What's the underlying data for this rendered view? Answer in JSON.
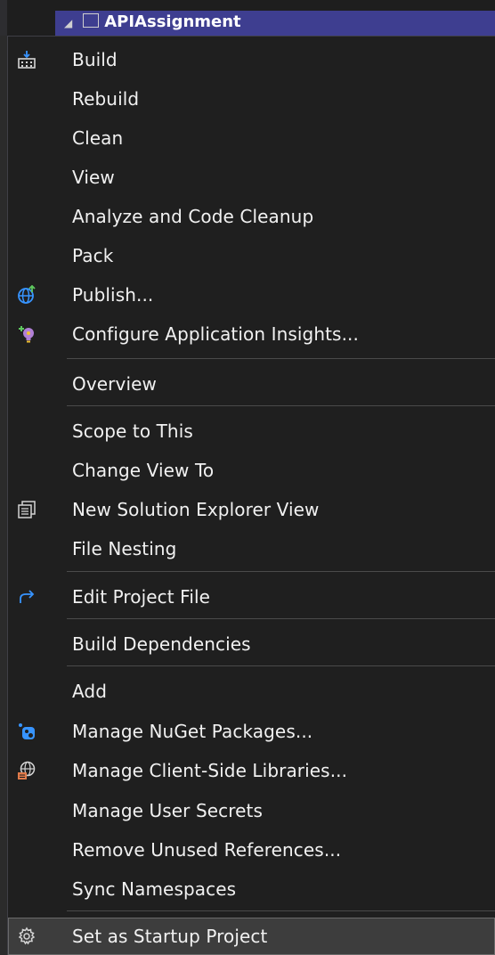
{
  "tree": {
    "selected_item": "APIAssignment"
  },
  "menu": {
    "items": [
      {
        "label": "Build",
        "icon": "build-icon"
      },
      {
        "label": "Rebuild",
        "icon": null
      },
      {
        "label": "Clean",
        "icon": null
      },
      {
        "label": "View",
        "icon": null
      },
      {
        "label": "Analyze and Code Cleanup",
        "icon": null
      },
      {
        "label": "Pack",
        "icon": null
      },
      {
        "label": "Publish...",
        "icon": "globe-publish-icon"
      },
      {
        "label": "Configure Application Insights...",
        "icon": "app-insights-lightbulb-icon"
      },
      {
        "label": "Overview",
        "icon": null
      },
      {
        "label": "Scope to This",
        "icon": null
      },
      {
        "label": "Change View To",
        "icon": null
      },
      {
        "label": "New Solution Explorer View",
        "icon": "solution-explorer-window-icon"
      },
      {
        "label": "File Nesting",
        "icon": null
      },
      {
        "label": "Edit Project File",
        "icon": "redo-arrow-icon"
      },
      {
        "label": "Build Dependencies",
        "icon": null
      },
      {
        "label": "Add",
        "icon": null
      },
      {
        "label": "Manage NuGet Packages...",
        "icon": "nuget-icon"
      },
      {
        "label": "Manage Client-Side Libraries...",
        "icon": "client-libraries-globe-icon"
      },
      {
        "label": "Manage User Secrets",
        "icon": null
      },
      {
        "label": "Remove Unused References...",
        "icon": null
      },
      {
        "label": "Sync Namespaces",
        "icon": null
      },
      {
        "label": "Set as Startup Project",
        "icon": "gear-icon"
      }
    ],
    "highlighted_item": "Set as Startup Project"
  },
  "colors": {
    "menu_background": "#1f1f1f",
    "separator": "#4a4a4a",
    "text": "#f1f1f1",
    "selection": "#3e3e90",
    "icon_blue": "#3794ff",
    "icon_green": "#5fc95f",
    "icon_purple": "#b180d7"
  }
}
